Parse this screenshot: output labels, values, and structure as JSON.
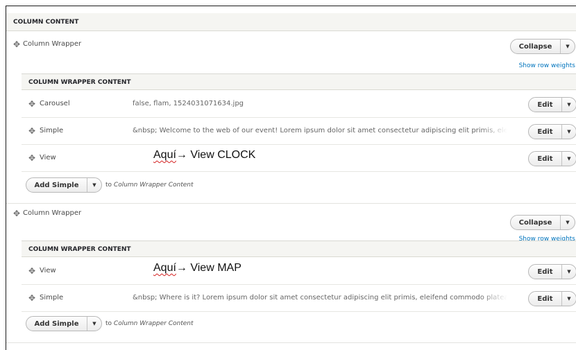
{
  "section_header": "COLUMN CONTENT",
  "wrappers": [
    {
      "label": "Column Wrapper",
      "collapse_label": "Collapse",
      "show_weights": "Show row weights",
      "content_header": "COLUMN WRAPPER CONTENT",
      "items": [
        {
          "label": "Carousel",
          "summary": "false, flam, 1524031071634.jpg",
          "edit": "Edit"
        },
        {
          "label": "Simple",
          "summary": "&nbsp; Welcome to the web of our event! Lorem ipsum dolor sit amet consectetur adipiscing elit primis, eleifend co",
          "edit": "Edit"
        },
        {
          "label": "View",
          "annot_a": "Aquí",
          "annot_b": "→ View CLOCK",
          "edit": "Edit"
        }
      ],
      "add_label": "Add Simple",
      "to_prefix": "to",
      "to_target": "Column Wrapper Content"
    },
    {
      "label": "Column Wrapper",
      "collapse_label": "Collapse",
      "show_weights": "Show row weights",
      "content_header": "COLUMN WRAPPER CONTENT",
      "items": [
        {
          "label": "View",
          "annot_a": "Aquí",
          "annot_b": "→ View MAP",
          "edit": "Edit"
        },
        {
          "label": "Simple",
          "summary": "&nbsp; Where is it? Lorem ipsum dolor sit amet consectetur adipiscing elit primis, eleifend commodo platea pharetra",
          "edit": "Edit"
        }
      ],
      "add_label": "Add Simple",
      "to_prefix": "to",
      "to_target": "Column Wrapper Content"
    }
  ]
}
